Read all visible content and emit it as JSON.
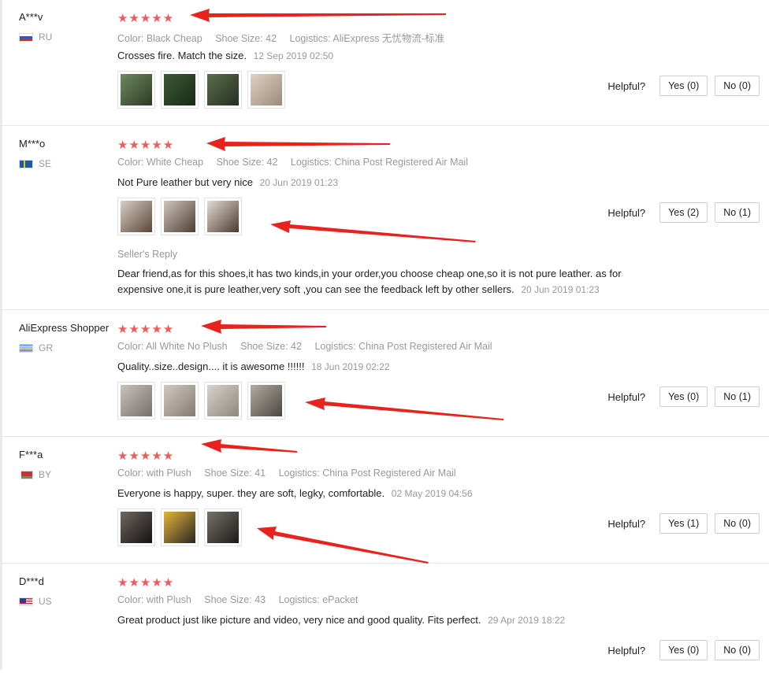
{
  "helpful_label": "Helpful?",
  "reviews": [
    {
      "user": "A***v",
      "country": "RU",
      "stars": "★★★★★",
      "meta": {
        "color": "Color: Black Cheap",
        "size": "Shoe Size: 42",
        "logistics": "Logistics: AliExpress 无忧物流-标准"
      },
      "text": "Crosses fire. Match the size.",
      "date": "12 Sep 2019 02:50",
      "yes": "Yes (0)",
      "no": "No (0)",
      "thumb_colors": [
        "#4a6a3e",
        "#2b4a2a",
        "#3f5a36",
        "#c9b8a6"
      ]
    },
    {
      "user": "M***o",
      "country": "SE",
      "stars": "★★★★★",
      "meta": {
        "color": "Color: White Cheap",
        "size": "Shoe Size: 42",
        "logistics": "Logistics: China Post Registered Air Mail"
      },
      "text": "Not Pure leather but very nice",
      "date": "20 Jun 2019 01:23",
      "yes": "Yes (2)",
      "no": "No (1)",
      "thumb_colors": [
        "#8a7566",
        "#7d6c62",
        "#6b5a50"
      ],
      "reply": {
        "label": "Seller's Reply",
        "text": "Dear friend,as for this shoes,it has two kinds,in your order,you choose cheap one,so it is not pure leather. as for expensive one,it is pure leather,very soft ,you can see the feedback left by other sellers.",
        "date": "20 Jun 2019 01:23"
      }
    },
    {
      "user": "AliExpress Shopper",
      "country": "GR",
      "stars": "★★★★★",
      "meta": {
        "color": "Color: All White No Plush",
        "size": "Shoe Size: 42",
        "logistics": "Logistics: China Post Registered Air Mail"
      },
      "text": "Quality..size..design.... it is awesome !!!!!!",
      "date": "18 Jun 2019 02:22",
      "yes": "Yes (0)",
      "no": "No (1)",
      "thumb_colors": [
        "#a9a39c",
        "#b0a89e",
        "#bdb6ad",
        "#8f877e"
      ]
    },
    {
      "user": "F***a",
      "country": "BY",
      "stars": "★★★★★",
      "meta": {
        "color": "Color: with Plush",
        "size": "Shoe Size: 41",
        "logistics": "Logistics: China Post Registered Air Mail"
      },
      "text": "Everyone is happy, super. they are soft, legky, comfortable.",
      "date": "02 May 2019 04:56",
      "yes": "Yes (1)",
      "no": "No (0)",
      "thumb_colors": [
        "#2e2a27",
        "#c99a2a",
        "#3a3836"
      ]
    },
    {
      "user": "D***d",
      "country": "US",
      "stars": "★★★★★",
      "meta": {
        "color": "Color: with Plush",
        "size": "Shoe Size: 43",
        "logistics": "Logistics: ePacket"
      },
      "text": "Great product just like picture and video, very nice and good quality. Fits perfect.",
      "date": "29 Apr 2019 18:22",
      "yes": "Yes (0)",
      "no": "No (0)",
      "thumb_colors": []
    }
  ]
}
